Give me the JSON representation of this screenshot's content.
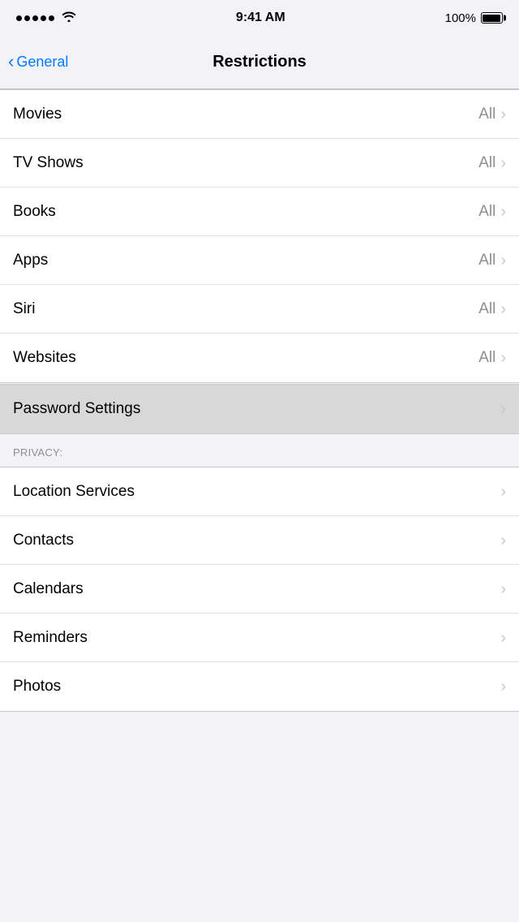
{
  "statusBar": {
    "time": "9:41 AM",
    "battery": "100%"
  },
  "navBar": {
    "backLabel": "General",
    "title": "Restrictions"
  },
  "contentSections": [
    {
      "id": "allowed-content",
      "rows": [
        {
          "id": "movies",
          "label": "Movies",
          "value": "All",
          "hasChevron": true
        },
        {
          "id": "tv-shows",
          "label": "TV Shows",
          "value": "All",
          "hasChevron": true
        },
        {
          "id": "books",
          "label": "Books",
          "value": "All",
          "hasChevron": true
        },
        {
          "id": "apps",
          "label": "Apps",
          "value": "All",
          "hasChevron": true
        },
        {
          "id": "siri",
          "label": "Siri",
          "value": "All",
          "hasChevron": true
        },
        {
          "id": "websites",
          "label": "Websites",
          "value": "All",
          "hasChevron": true
        }
      ]
    },
    {
      "id": "password",
      "rows": [
        {
          "id": "password-settings",
          "label": "Password Settings",
          "value": "",
          "hasChevron": true,
          "highlighted": true
        }
      ]
    },
    {
      "id": "privacy",
      "header": "PRIVACY:",
      "rows": [
        {
          "id": "location-services",
          "label": "Location Services",
          "value": "",
          "hasChevron": true
        },
        {
          "id": "contacts",
          "label": "Contacts",
          "value": "",
          "hasChevron": true
        },
        {
          "id": "calendars",
          "label": "Calendars",
          "value": "",
          "hasChevron": true
        },
        {
          "id": "reminders",
          "label": "Reminders",
          "value": "",
          "hasChevron": true
        },
        {
          "id": "photos",
          "label": "Photos",
          "value": "",
          "hasChevron": true
        }
      ]
    }
  ]
}
